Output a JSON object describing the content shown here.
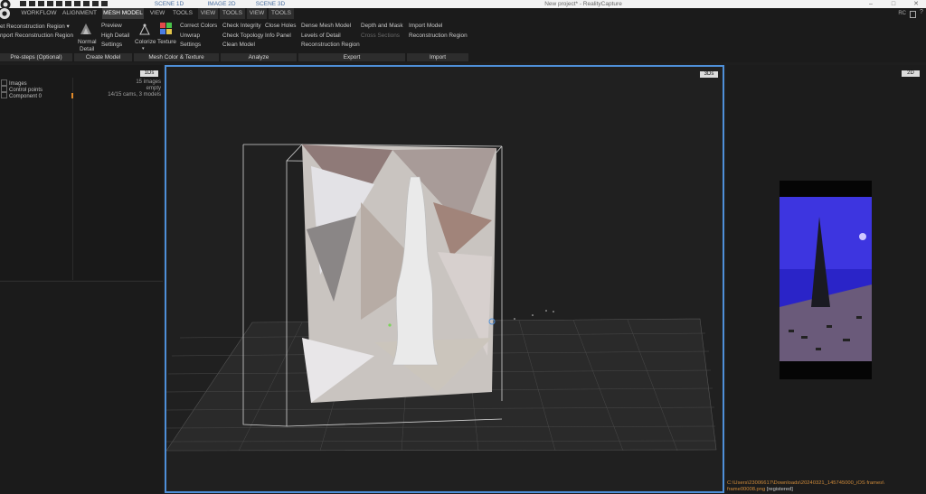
{
  "titlebar": {
    "scene_tabs": [
      "SCENE 1D",
      "IMAGE 2D",
      "SCENE 3D"
    ],
    "app_title": "New project* - RealityCapture",
    "window_buttons": [
      "–",
      "□",
      "✕"
    ]
  },
  "menu": {
    "items": [
      "WORKFLOW",
      "ALIGNMENT",
      "MESH MODEL",
      "VIEW",
      "TOOLS",
      "VIEW",
      "TOOLS",
      "VIEW",
      "TOOLS"
    ],
    "active_index": 2,
    "rc_label": "RC"
  },
  "ribbon": {
    "prestep": {
      "set_region": "et Reconstruction Region ▾",
      "import_region": "nport Reconstruction Region",
      "group": "Pre-steps (Optional)"
    },
    "create_model": {
      "normal_detail_line1": "Normal",
      "normal_detail_line2": "Detail",
      "preview": "Preview",
      "high_detail": "High Detail",
      "settings": "Settings",
      "group": "Create Model"
    },
    "color_texture": {
      "colorize": "Colorize",
      "texture": "Texture",
      "correct_colors": "Correct Colors",
      "unwrap": "Unwrap",
      "settings": "Settings",
      "group": "Mesh Color & Texture"
    },
    "analyze": {
      "check_integrity": "Check Integrity",
      "close_holes": "Close Holes",
      "check_topology": "Check Topology",
      "info_panel": "Info Panel",
      "clean_model": "Clean Model",
      "group": "Analyze"
    },
    "export": {
      "dense_mesh": "Dense Mesh Model",
      "depth_mask": "Depth and Mask",
      "lod": "Levels of Detail",
      "cross_sections": "Cross Sections",
      "recon_region": "Reconstruction Region",
      "group": "Export"
    },
    "import": {
      "import_model": "Import Model",
      "recon_region": "Reconstruction Region",
      "group": "Import"
    }
  },
  "panel1d": {
    "tab": "1Ds",
    "rows": [
      {
        "label": "Images",
        "value": "15 images"
      },
      {
        "label": "Control points",
        "value": "empty"
      },
      {
        "label": "Component 0",
        "value": "14/15 cams, 3 models"
      }
    ]
  },
  "viewport3d": {
    "tab": "3Ds"
  },
  "viewport2d": {
    "tab": "2D"
  },
  "status": {
    "path_line1": "C:\\Users\\23006617\\Downloads\\20240321_145745000_iOS frames\\",
    "path_line2": "frame00008.png",
    "tag": "[registered]"
  },
  "colors": {
    "accent": "#4e8fd8",
    "status_text": "#d08b3a",
    "background": "#1e1e1e"
  }
}
